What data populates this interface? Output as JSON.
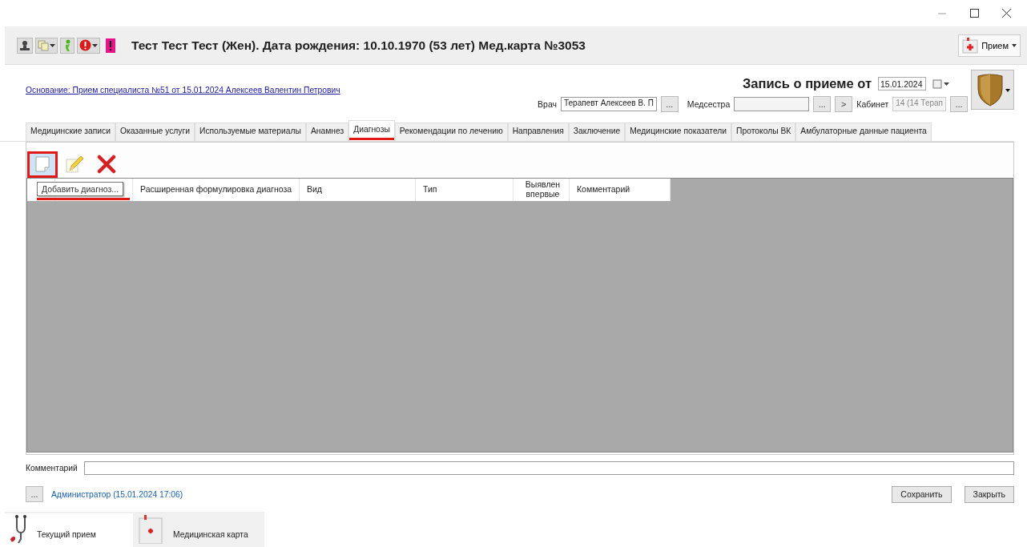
{
  "header": {
    "title": "Тест Тест Тест (Жен). Дата рождения: 10.10.1970 (53 лет) Мед.карта №3053",
    "reception_button": "Прием"
  },
  "basis_link": "Основание: Прием специалиста №51 от 15.01.2024 Алексеев Валентин Петрович",
  "record": {
    "heading": "Запись о приеме от",
    "date": "15.01.2024"
  },
  "staff": {
    "doctor_label": "Врач",
    "doctor": "Терапевт Алексеев В. П",
    "doctor_browse": "...",
    "nurse_label": "Медсестра",
    "nurse_browse": "...",
    "next_button": ">",
    "room_label": "Кабинет",
    "room": "14 (14 Терап",
    "room_disabled": true,
    "room_browse": "..."
  },
  "tabs": [
    {
      "label": "Медицинские записи",
      "selected": false
    },
    {
      "label": "Оказанные услуги",
      "selected": false
    },
    {
      "label": "Используемые материалы",
      "selected": false
    },
    {
      "label": "Анамнез",
      "selected": false
    },
    {
      "label": "Диагнозы",
      "selected": true
    },
    {
      "label": "Рекомендации по лечению",
      "selected": false
    },
    {
      "label": "Направления",
      "selected": false
    },
    {
      "label": "Заключение",
      "selected": false
    },
    {
      "label": "Медицинские показатели",
      "selected": false
    },
    {
      "label": "Протоколы ВК",
      "selected": false
    },
    {
      "label": "Амбулаторные данные пациента",
      "selected": false
    }
  ],
  "toolbar": [
    {
      "kind": "add",
      "highlighted": true
    },
    {
      "kind": "edit",
      "highlighted": false
    },
    {
      "kind": "delete",
      "highlighted": false
    }
  ],
  "tooltip": {
    "text": "Добавить диагноз...",
    "underlined": true
  },
  "grid": {
    "columns": [
      "Расширенная формулировка диагноза",
      "Вид",
      "Тип",
      "Выявлен впервые",
      "Комментарий"
    ]
  },
  "comment": {
    "label": "Комментарий"
  },
  "footer": {
    "more_button": "...",
    "author": "Администратор (15.01.2024 17:06)",
    "save_button": "Сохранить",
    "close_button": "Закрыть"
  },
  "bottom_tabs": [
    {
      "label": "Текущий прием",
      "selected": true
    },
    {
      "label": "Медицинская карта",
      "selected": false
    }
  ]
}
